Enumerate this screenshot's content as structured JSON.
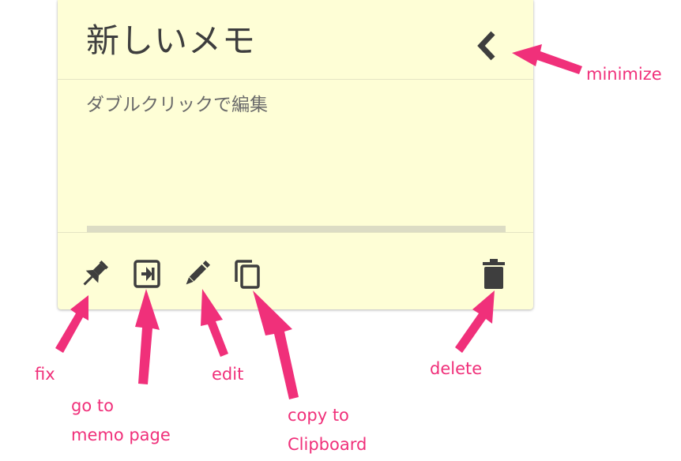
{
  "memo": {
    "title": "新しいメモ",
    "body_text": "ダブルクリックで編集"
  },
  "icons": {
    "minimize": "chevron-left-icon",
    "fix": "pin-icon",
    "go_to_memo_page": "exit-to-app-icon",
    "edit": "pencil-icon",
    "copy": "copy-icon",
    "delete": "trash-icon"
  },
  "annotations": {
    "minimize": "minimize",
    "fix": "fix",
    "go_to_memo_page": [
      "go to",
      "memo page"
    ],
    "edit": "edit",
    "copy_to_clipboard": [
      "copy to",
      "Clipboard"
    ],
    "delete": "delete"
  },
  "colors": {
    "card_background": "#fefed6",
    "icon": "#3e3e3e",
    "annotation": "#f0307a"
  }
}
